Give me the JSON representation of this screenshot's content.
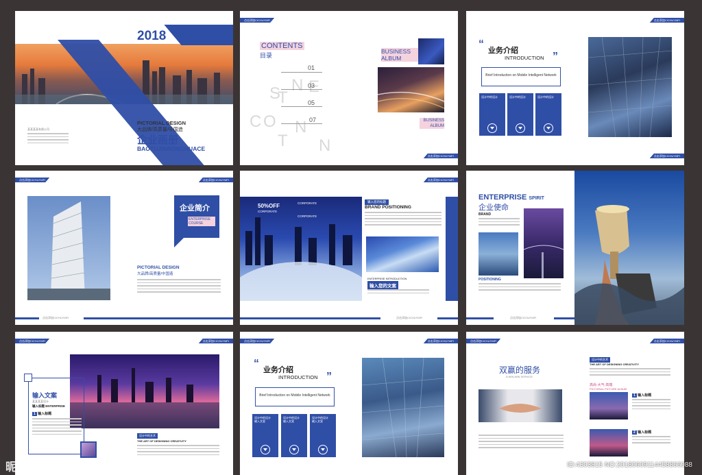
{
  "cover": {
    "year": "2018",
    "subtitle_en": "PICTORIAL DESIGN",
    "subtitle_cn": "大品牌/高质量/中国造",
    "title_cn": "企业画册",
    "title_pinyin": "BAOTUJINRONGHUACE",
    "company": "某某某某有限公司"
  },
  "contents": {
    "tag": "点击添加CICHUYMFI",
    "title_en": "CONTENTS",
    "title_cn": "目录",
    "nums": [
      "01",
      "03",
      "05",
      "07"
    ],
    "album_title": "BUSINESS ALBUM",
    "album_sub": "BUSINESS ALBUM",
    "bg_letters": [
      "N",
      "T",
      "S",
      "E",
      "C",
      "O",
      "N",
      "T",
      "N"
    ]
  },
  "biz1": {
    "tag": "点击添加CICHUYMFI",
    "title_cn": "业务介绍",
    "title_en": "INTRODUCTION",
    "box_text": "Brief Introduction on Mobile Intelligent Network",
    "cards": [
      "设计中的设计",
      "设计中的设计",
      "设计中的设计"
    ]
  },
  "about": {
    "tag": "点击添加CICHUYMFI",
    "bubble_cn": "企业简介",
    "bubble_sub": "ENTERPRISE COURSE",
    "pd_en": "PICTORIAL DESIGN",
    "pd_cn": "大品牌/高质量/中国造",
    "footer_tag": "点击添加CICHUYMFI"
  },
  "brand": {
    "tag": "点击添加CICHUYMFI",
    "off": "50%OFF",
    "corporate": "CORPORATE",
    "corporate2": "CORPORATE",
    "label_top": "输入您的标题",
    "positioning": "BRAND POSITIONING",
    "enterprise_intro": "ENTERPRISE INTRODUCTION",
    "input_cn": "输入您的文案",
    "footer_tag": "点击添加CICHUYMFI"
  },
  "spirit": {
    "title_en": "ENTERPRISE",
    "title_en2": "SPIRIT",
    "title_cn": "企业使命",
    "brand_label": "BRAND",
    "positioning_label": "POSITIONING",
    "footer_tag": "点击添加CICHUYMFI"
  },
  "citypage": {
    "tag": "点击添加CICHUYMFI",
    "title_cn": "输入文案",
    "sub": "输入标题 ENTERPRISE",
    "item": "输入标题",
    "art_label": "设计中的艺术",
    "art_en": "THE ART OF DESIGNING CREATIVITY"
  },
  "biz2": {
    "tag": "点击添加CICHUYMFI",
    "title_cn": "业务介绍",
    "title_en": "INTRODUCTION",
    "box_text": "Brief Introduction on Mobile Intelligent Network",
    "cards": [
      "设计中的设计",
      "设计中的设计",
      "设计中的设计"
    ],
    "card_sub": "输入文案"
  },
  "service": {
    "tag": "点击添加CICHUYMFI",
    "title_cn": "双赢的服务",
    "title_en": "A WIN-WIN SERVICE",
    "art_label": "设计中的艺术",
    "art_en": "THE ART OF DESIGNING CREATIVITY",
    "album": "PICTORIAL PICTURE ALBUM",
    "item": "输入标题"
  },
  "watermark": {
    "logo": "昵图网",
    "url": "www.nipic.com",
    "id": "ID:4303815 NO:20180609114458866088"
  }
}
